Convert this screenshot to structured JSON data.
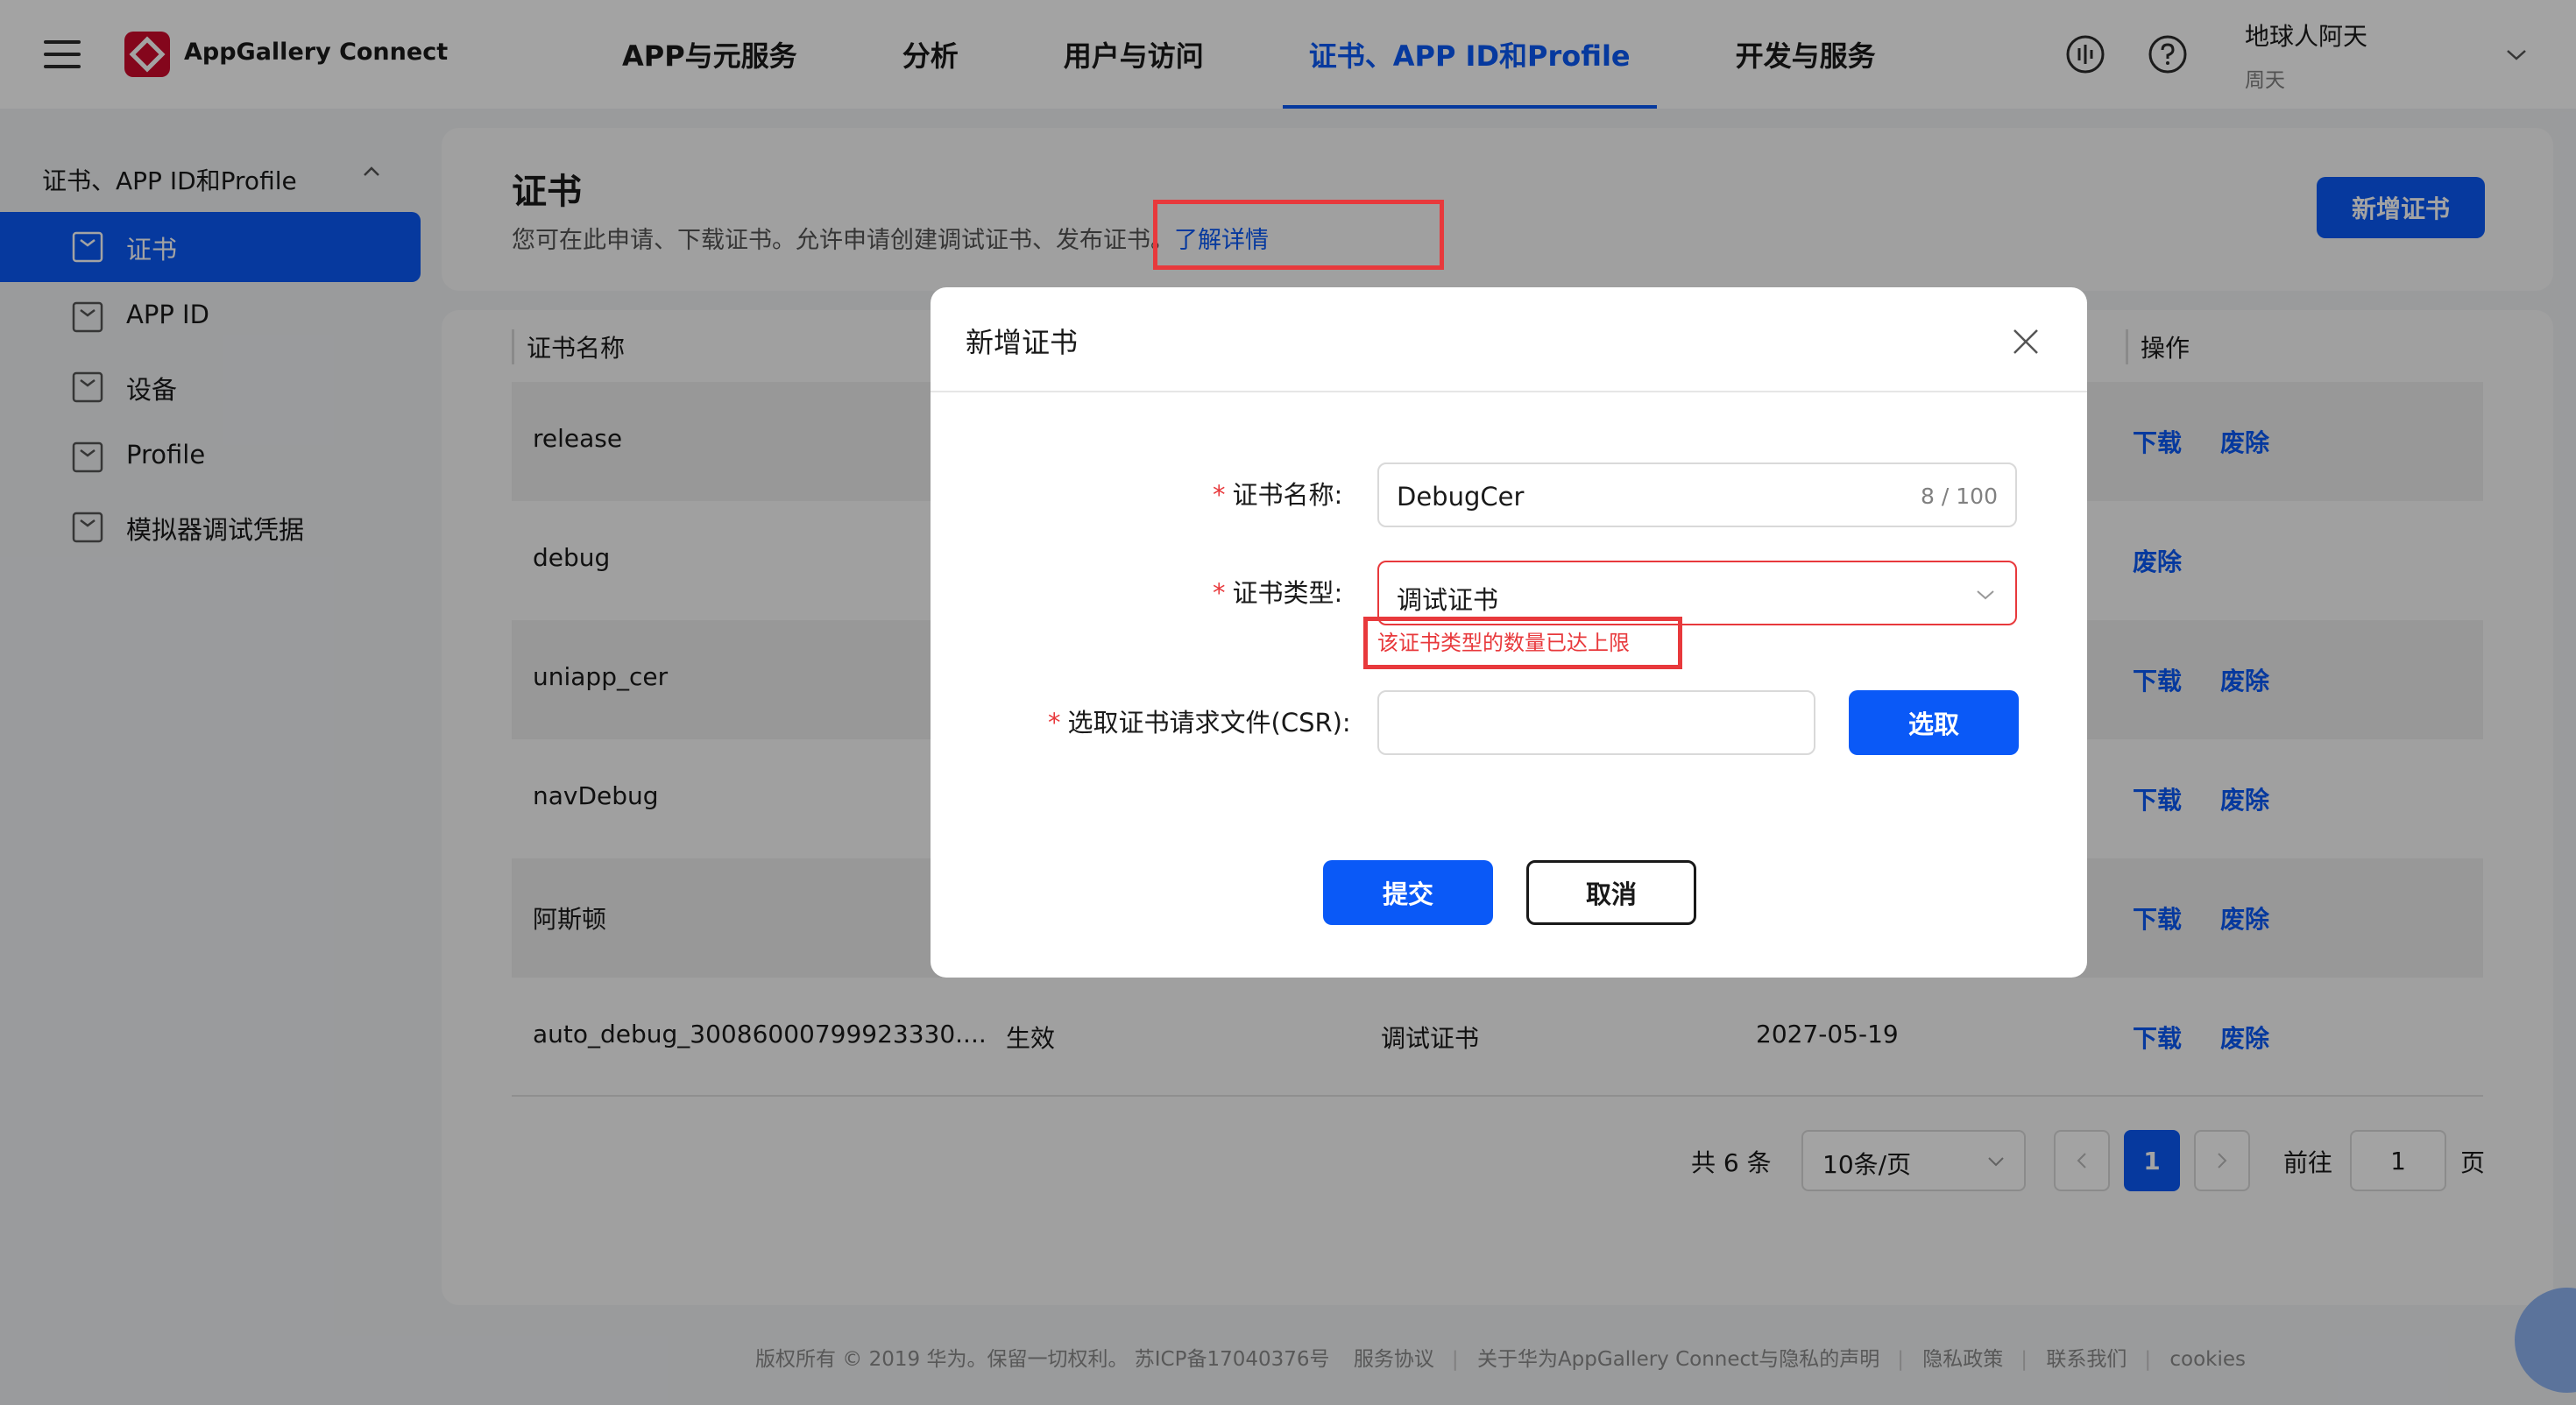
{
  "header": {
    "brand": "AppGallery Connect",
    "nav": [
      "APP与元服务",
      "分析",
      "用户与访问",
      "证书、APP ID和Profile",
      "开发与服务"
    ],
    "user_name": "地球人阿天",
    "user_sub": "周天",
    "icons": [
      "menu-icon",
      "app-logo",
      "feedback-icon",
      "help-icon",
      "chevron-down-icon"
    ]
  },
  "sidebar": {
    "group": "证书、APP ID和Profile",
    "items": [
      "证书",
      "APP ID",
      "设备",
      "Profile",
      "模拟器调试凭据"
    ]
  },
  "page": {
    "title": "证书",
    "desc": "您可在此申请、下载证书。允许申请创建调试证书、发布证书。",
    "link": "了解详情",
    "new_button": "新增证书"
  },
  "table": {
    "headers": [
      "证书名称",
      "操作"
    ],
    "rows": [
      {
        "name": "release",
        "status": "",
        "type": "",
        "expiry": "",
        "download": "下载",
        "revoke": "废除"
      },
      {
        "name": "debug",
        "status": "",
        "type": "",
        "expiry": "",
        "download": "",
        "revoke": "废除"
      },
      {
        "name": "uniapp_cer",
        "status": "",
        "type": "",
        "expiry": "",
        "download": "下载",
        "revoke": "废除"
      },
      {
        "name": "navDebug",
        "status": "",
        "type": "",
        "expiry": "",
        "download": "下载",
        "revoke": "废除"
      },
      {
        "name": "阿斯顿",
        "status": "",
        "type": "",
        "expiry": "",
        "download": "下载",
        "revoke": "废除"
      },
      {
        "name": "auto_debug_30086000799923330....",
        "status": "生效",
        "type": "调试证书",
        "expiry": "2027-05-19",
        "download": "下载",
        "revoke": "废除"
      }
    ]
  },
  "pagination": {
    "total": "共 6 条",
    "page_size": "10条/页",
    "current": "1",
    "goto_label": "前往",
    "goto_value": "1",
    "unit": "页"
  },
  "footer": {
    "copyright": "版权所有 © 2019 华为。保留一切权利。 苏ICP备17040376号",
    "links": [
      "服务协议",
      "关于华为AppGallery Connect与隐私的声明",
      "隐私政策",
      "联系我们",
      "cookies"
    ]
  },
  "dialog": {
    "title": "新增证书",
    "name_label": "证书名称:",
    "name_value": "DebugCer",
    "name_count": "8 / 100",
    "type_label": "证书类型:",
    "type_value": "调试证书",
    "type_error": "该证书类型的数量已达上限",
    "csr_label": "选取证书请求文件(CSR):",
    "csr_value": "",
    "pick_button": "选取",
    "submit_button": "提交",
    "cancel_button": "取消",
    "required_mark": "*"
  },
  "colors": {
    "accent": "#0a59f7",
    "error": "#e8393c",
    "logo": "#cf0a2c"
  }
}
